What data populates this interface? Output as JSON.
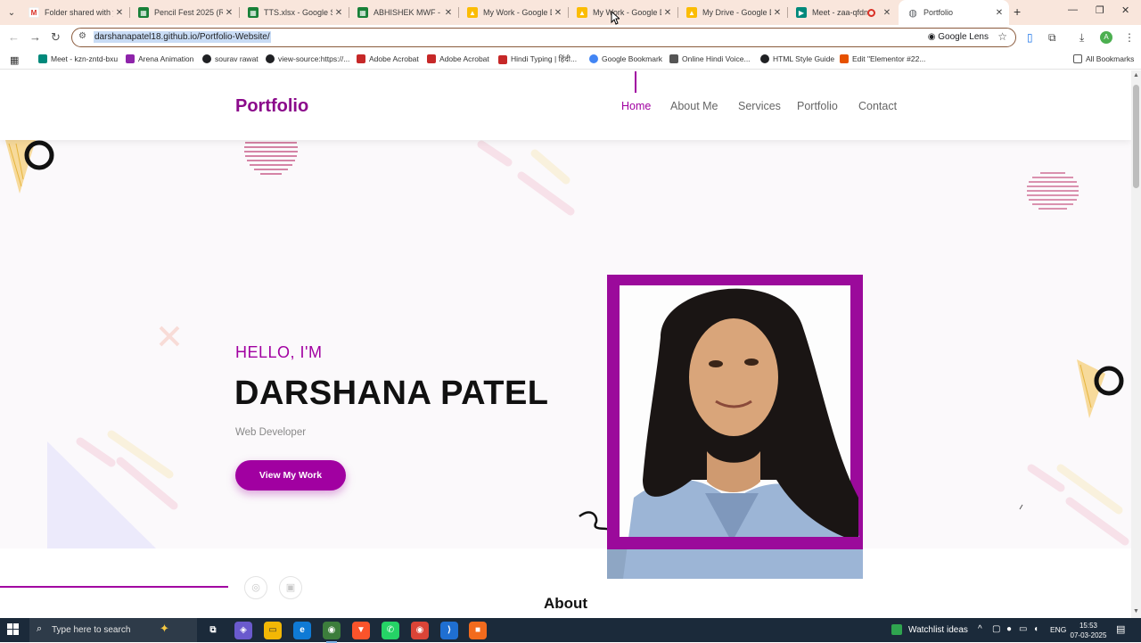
{
  "browser": {
    "tabs": [
      {
        "title": "Folder shared with yo",
        "icon": "gmail-icon",
        "color": "#d93025"
      },
      {
        "title": "Pencil Fest 2025 (Resp",
        "icon": "sheets-icon",
        "color": "#188038"
      },
      {
        "title": "TTS.xlsx - Google She",
        "icon": "sheets-icon",
        "color": "#188038"
      },
      {
        "title": "ABHISHEK MWF - Go",
        "icon": "sheets-icon",
        "color": "#188038"
      },
      {
        "title": "My Work - Google Dr",
        "icon": "drive-icon",
        "color": "#1a73e8"
      },
      {
        "title": "My Work - Google Dr",
        "icon": "drive-icon",
        "color": "#1a73e8"
      },
      {
        "title": "My Drive - Google Dri",
        "icon": "drive-icon",
        "color": "#1a73e8"
      },
      {
        "title": "Meet - zaa-qfdn",
        "icon": "meet-icon",
        "color": "#00897b"
      },
      {
        "title": "Portfolio",
        "icon": "globe-icon",
        "color": "#5f6368"
      }
    ],
    "new_tab": "+",
    "url": "darshanapatel18.github.io/Portfolio-Website/",
    "lens_label": "Google Lens",
    "profile_initial": "A"
  },
  "bookmarks": [
    {
      "label": "Meet - kzn-zntd-bxu",
      "color": "#00897b"
    },
    {
      "label": "Arena Animation",
      "color": "#8e24aa"
    },
    {
      "label": "sourav rawat",
      "color": "#202124"
    },
    {
      "label": "view-source:https://...",
      "color": "#202124"
    },
    {
      "label": "Adobe Acrobat",
      "color": "#c62828"
    },
    {
      "label": "Adobe Acrobat",
      "color": "#c62828"
    },
    {
      "label": "Hindi Typing | हिंदी...",
      "color": "#c62828"
    },
    {
      "label": "Google Bookmark",
      "color": "#4285f4"
    },
    {
      "label": "Online Hindi Voice...",
      "color": "#555555"
    },
    {
      "label": "HTML Style Guide",
      "color": "#202124"
    },
    {
      "label": "Edit \"Elementor #22...",
      "color": "#e65100"
    }
  ],
  "all_bookmarks": "All Bookmarks",
  "site": {
    "logo": "Portfolio",
    "nav": [
      "Home",
      "About Me",
      "Services",
      "Portfolio",
      "Contact"
    ],
    "active_nav": "Home",
    "greeting": "HELLO, I'M",
    "name": "DARSHANA PATEL",
    "role": "Web Developer",
    "cta": "View My Work",
    "social": [
      "instagram-icon",
      "linkedin-icon"
    ],
    "section_title": "About",
    "accent": "#a100a1"
  },
  "taskbar": {
    "search_placeholder": "Type here to search",
    "watchlist": "Watchlist ideas",
    "language": "ENG",
    "time": "15:53",
    "date": "07-03-2025"
  }
}
